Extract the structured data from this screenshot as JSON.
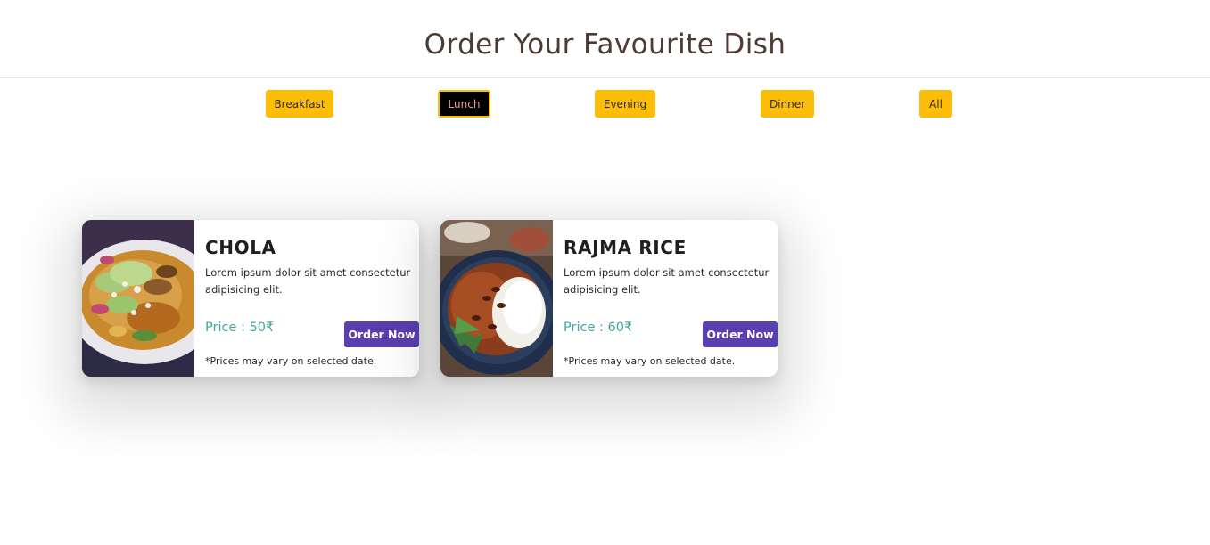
{
  "header": {
    "title": "Order Your Favourite Dish"
  },
  "filters": [
    {
      "label": "Breakfast",
      "active": false
    },
    {
      "label": "Lunch",
      "active": true
    },
    {
      "label": "Evening",
      "active": false
    },
    {
      "label": "Dinner",
      "active": false
    },
    {
      "label": "All",
      "active": false
    }
  ],
  "dishes": [
    {
      "name": "CHOLA",
      "description": "Lorem ipsum dolor sit amet consectetur adipisicing elit.",
      "price": "Price : 50₹",
      "order_label": "Order Now",
      "note": "*Prices may vary on selected date.",
      "image": "chola-dish-photo"
    },
    {
      "name": "RAJMA RICE",
      "description": "Lorem ipsum dolor sit amet consectetur adipisicing elit.",
      "price": "Price : 60₹",
      "order_label": "Order Now",
      "note": "*Prices may vary on selected date.",
      "image": "rajma-rice-photo"
    }
  ],
  "colors": {
    "filter_bg": "#fbbd08",
    "filter_active_bg": "#000000",
    "order_button": "#5a3fb0",
    "price_text": "#3fa89c",
    "title_text": "#4e3b34"
  }
}
